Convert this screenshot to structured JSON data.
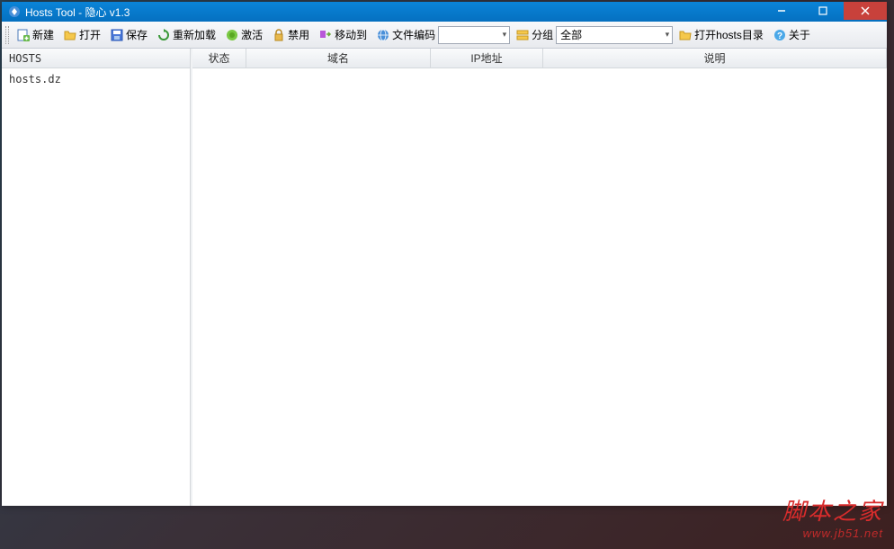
{
  "title": "Hosts Tool - 隐心 v1.3",
  "toolbar": {
    "new": "新建",
    "open": "打开",
    "save": "保存",
    "reload": "重新加载",
    "activate": "激活",
    "disable": "禁用",
    "moveto": "移动到",
    "encoding_label": "文件编码",
    "encoding_value": "",
    "group_label": "分组",
    "group_value": "全部",
    "open_hosts_dir": "打开hosts目录",
    "about": "关于"
  },
  "sidebar": {
    "header": "HOSTS",
    "items": [
      "hosts.dz"
    ]
  },
  "table": {
    "columns": {
      "status": "状态",
      "domain": "域名",
      "ip": "IP地址",
      "desc": "说明"
    },
    "rows": []
  },
  "watermark": {
    "main": "脚本之家",
    "sub": "www.jb51.net"
  }
}
